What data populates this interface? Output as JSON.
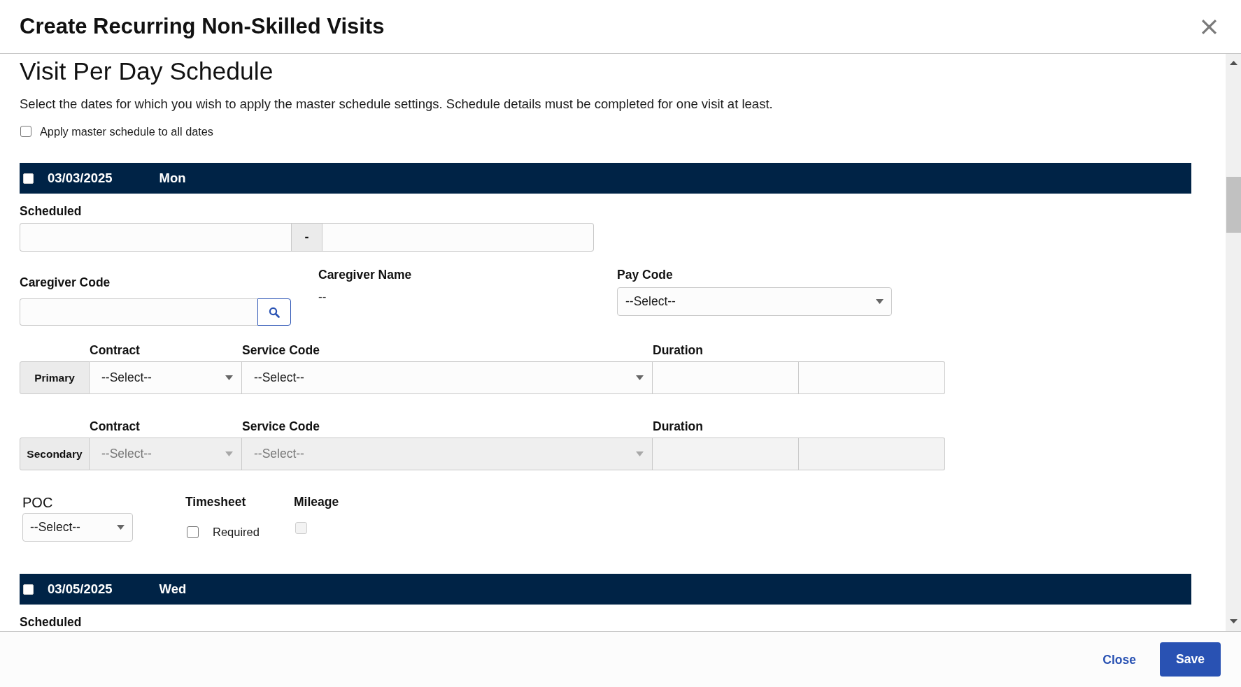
{
  "dialog": {
    "title": "Create Recurring Non-Skilled Visits"
  },
  "section": {
    "heading": "Visit Per Day Schedule",
    "description": "Select the dates for which you wish to apply the master schedule settings. Schedule details must be completed for one visit at least.",
    "apply_all": {
      "label": "Apply master schedule to all dates",
      "checked": false
    }
  },
  "days": [
    {
      "date": "03/03/2025",
      "weekday": "Mon",
      "checked": false,
      "scheduled": {
        "label": "Scheduled",
        "separator": "-"
      },
      "caregiver_code": {
        "label": "Caregiver Code"
      },
      "caregiver_name": {
        "label": "Caregiver Name",
        "value": "--"
      },
      "pay_code": {
        "label": "Pay Code",
        "value": "--Select--"
      },
      "services": [
        {
          "tag": "Primary",
          "disabled": false,
          "contract": {
            "label": "Contract",
            "value": "--Select--"
          },
          "service_code": {
            "label": "Service Code",
            "value": "--Select--"
          },
          "duration": {
            "label": "Duration"
          }
        },
        {
          "tag": "Secondary",
          "disabled": true,
          "contract": {
            "label": "Contract",
            "value": "--Select--"
          },
          "service_code": {
            "label": "Service Code",
            "value": "--Select--"
          },
          "duration": {
            "label": "Duration"
          }
        }
      ],
      "poc": {
        "label": "POC",
        "value": "--Select--"
      },
      "timesheet": {
        "label": "Timesheet",
        "option": "Required",
        "checked": false
      },
      "mileage": {
        "label": "Mileage",
        "checked": false,
        "disabled": true
      }
    },
    {
      "date": "03/05/2025",
      "weekday": "Wed",
      "checked": false,
      "scheduled": {
        "label": "Scheduled"
      }
    }
  ],
  "footer": {
    "buttons": [
      {
        "label": "Close",
        "kind": "link"
      },
      {
        "label": "Save",
        "kind": "primary"
      }
    ]
  }
}
